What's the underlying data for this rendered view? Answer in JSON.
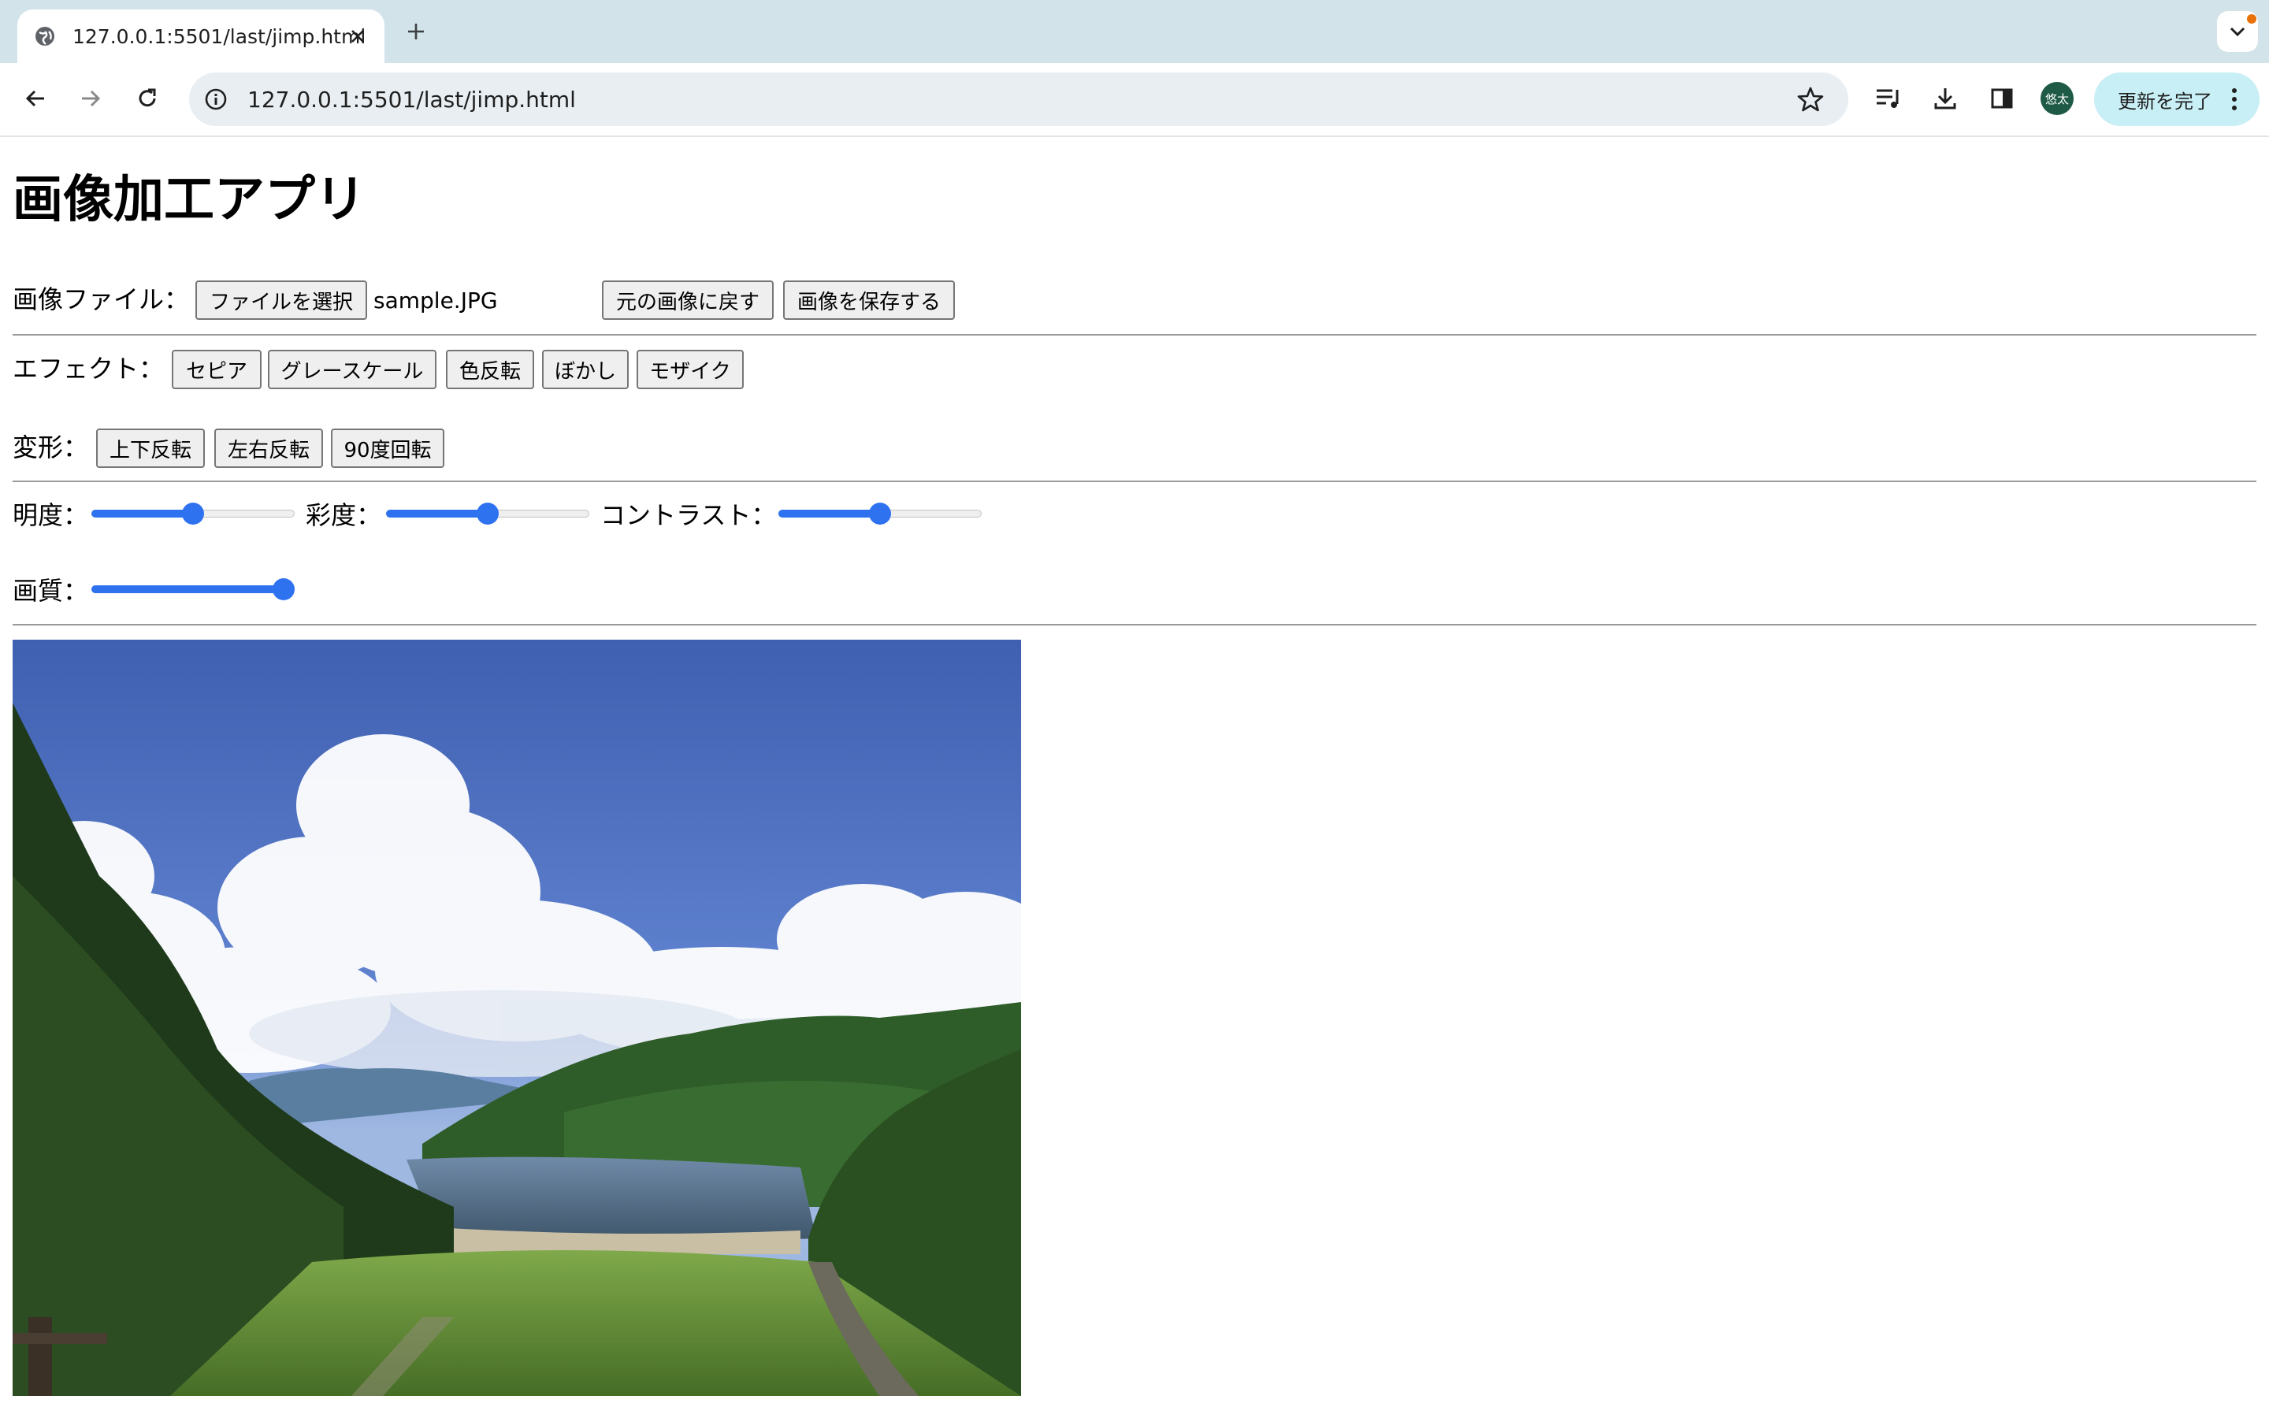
{
  "browser": {
    "tab_title": "127.0.0.1:5501/last/jimp.html",
    "url": "127.0.0.1:5501/last/jimp.html",
    "profile_initials": "悠太",
    "update_button": "更新を完了"
  },
  "app": {
    "title": "画像加工アプリ",
    "file_label": "画像ファイル：",
    "file_button": "ファイルを選択",
    "file_name": "sample.JPG",
    "reset_button": "元の画像に戻す",
    "save_button": "画像を保存する",
    "effect_label": "エフェクト：",
    "effects": [
      "セピア",
      "グレースケール",
      "色反転",
      "ぼかし",
      "モザイク"
    ],
    "transform_label": "変形：",
    "transforms": [
      "上下反転",
      "左右反転",
      "90度回転"
    ],
    "sliders": {
      "brightness": {
        "label": "明度：",
        "value": 0.5
      },
      "saturation": {
        "label": "彩度：",
        "value": 0.5
      },
      "contrast": {
        "label": "コントラスト：",
        "value": 0.5
      },
      "quality": {
        "label": "画質：",
        "value": 1.0
      }
    }
  },
  "colors": {
    "accent": "#2f72f0",
    "tabbar": "#d3e3ea",
    "update_button_bg": "#c9eff6"
  }
}
